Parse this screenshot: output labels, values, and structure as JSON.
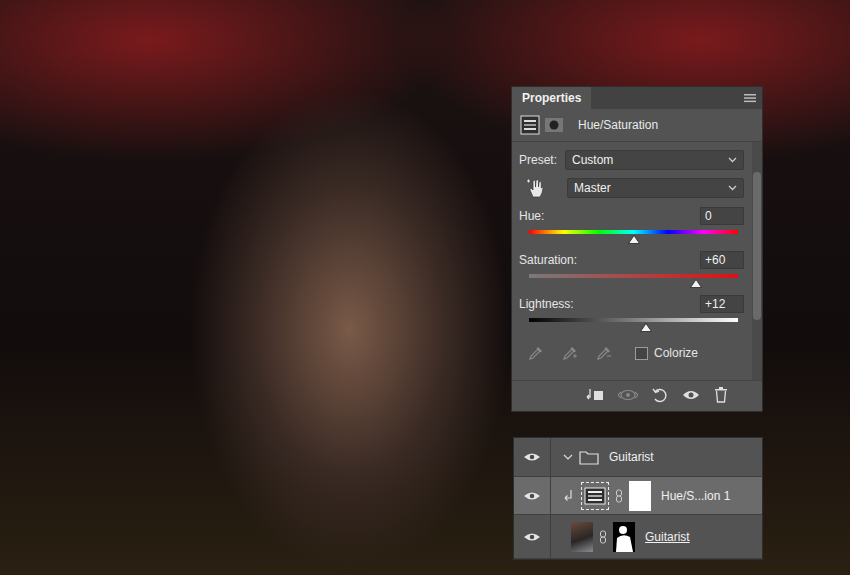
{
  "properties": {
    "title": "Properties",
    "adjustment": "Hue/Saturation",
    "preset": {
      "label": "Preset:",
      "value": "Custom"
    },
    "channel": {
      "value": "Master"
    },
    "sliders": [
      {
        "label": "Hue:",
        "value": "0",
        "level": 0.5,
        "kind": "hue"
      },
      {
        "label": "Saturation:",
        "value": "+60",
        "level": 0.8,
        "kind": "saturation"
      },
      {
        "label": "Lightness:",
        "value": "+12",
        "level": 0.56,
        "kind": "lightness"
      }
    ],
    "colorize": {
      "label": "Colorize",
      "checked": false
    }
  },
  "layers": [
    {
      "name": "Guitarist",
      "kind": "group",
      "visible": true,
      "expanded": true,
      "clipped": false,
      "underlined": false,
      "selected": false
    },
    {
      "name": "Hue/S...ion 1",
      "kind": "adjustment",
      "visible": true,
      "expanded": false,
      "clipped": true,
      "underlined": false,
      "selected": true
    },
    {
      "name": "Guitarist",
      "kind": "pixel",
      "visible": true,
      "expanded": false,
      "clipped": false,
      "underlined": true,
      "selected": false
    }
  ]
}
